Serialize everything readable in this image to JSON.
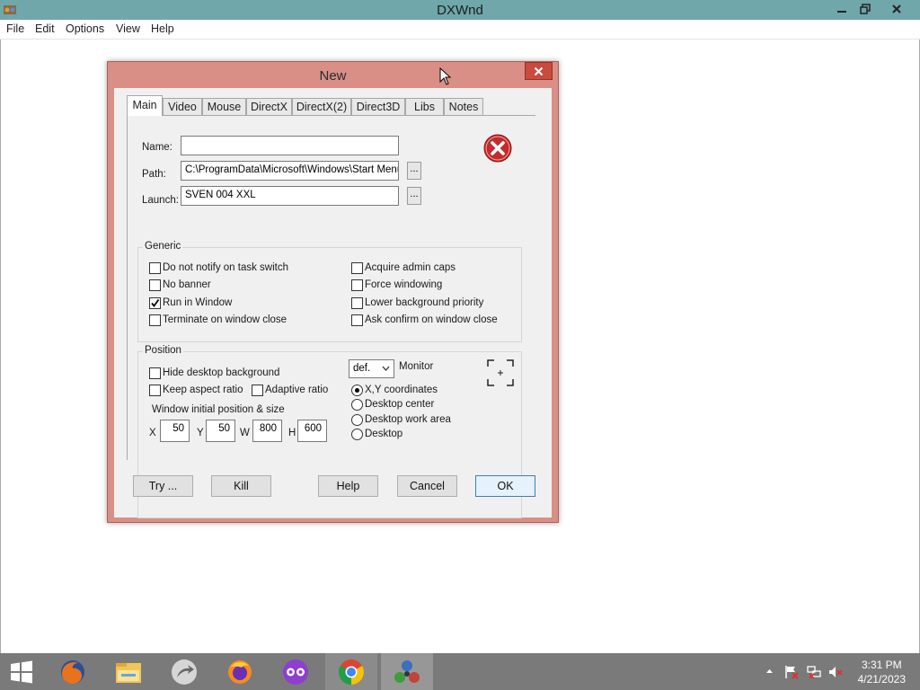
{
  "app": {
    "title": "DXWnd"
  },
  "menu": [
    "File",
    "Edit",
    "Options",
    "View",
    "Help"
  ],
  "dialog": {
    "title": "New",
    "tabs": [
      "Main",
      "Video",
      "Mouse",
      "DirectX",
      "DirectX(2)",
      "Direct3D",
      "Libs",
      "Notes"
    ],
    "active_tab": "Main",
    "fields": {
      "name_label": "Name:",
      "name_value": "",
      "path_label": "Path:",
      "path_value": "C:\\ProgramData\\Microsoft\\Windows\\Start Menu\\",
      "launch_label": "Launch:",
      "launch_value": "SVEN 004 XXL",
      "browse_label": "..."
    },
    "generic": {
      "title": "Generic",
      "options": [
        {
          "label": "Do not notify on task switch",
          "checked": false
        },
        {
          "label": "Acquire admin caps",
          "checked": false
        },
        {
          "label": "No banner",
          "checked": false
        },
        {
          "label": "Force windowing",
          "checked": false
        },
        {
          "label": "Run in Window",
          "checked": true
        },
        {
          "label": "Lower background priority",
          "checked": false
        },
        {
          "label": "Terminate on window close",
          "checked": false
        },
        {
          "label": "Ask confirm on window close",
          "checked": false
        }
      ]
    },
    "position": {
      "title": "Position",
      "hide_desktop": {
        "label": "Hide desktop background",
        "checked": false
      },
      "keep_aspect": {
        "label": "Keep aspect ratio",
        "checked": false
      },
      "adaptive": {
        "label": "Adaptive ratio",
        "checked": false
      },
      "init_label": "Window initial position & size",
      "x_label": "X",
      "x_value": "50",
      "y_label": "Y",
      "y_value": "50",
      "w_label": "W",
      "w_value": "800",
      "h_label": "H",
      "h_value": "600",
      "monitor_select": "def.",
      "monitor_label": "Monitor",
      "modes": [
        {
          "label": "X,Y coordinates",
          "selected": true
        },
        {
          "label": "Desktop center",
          "selected": false
        },
        {
          "label": "Desktop work area",
          "selected": false
        },
        {
          "label": "Desktop",
          "selected": false
        }
      ]
    },
    "buttons": {
      "try": "Try ...",
      "kill": "Kill",
      "help": "Help",
      "cancel": "Cancel",
      "ok": "OK"
    }
  },
  "taskbar": {
    "apps": [
      "firefox-orange",
      "file-explorer",
      "app-arrow",
      "firefox",
      "mask-app",
      "chrome",
      "dxwnd"
    ],
    "time": "3:31 PM",
    "date": "4/21/2023"
  },
  "colors": {
    "titlebar": "#6fa7aa",
    "dialog_frame": "#d98f86",
    "taskbar": "#7a7a7a",
    "close_red": "#c74b3e"
  }
}
